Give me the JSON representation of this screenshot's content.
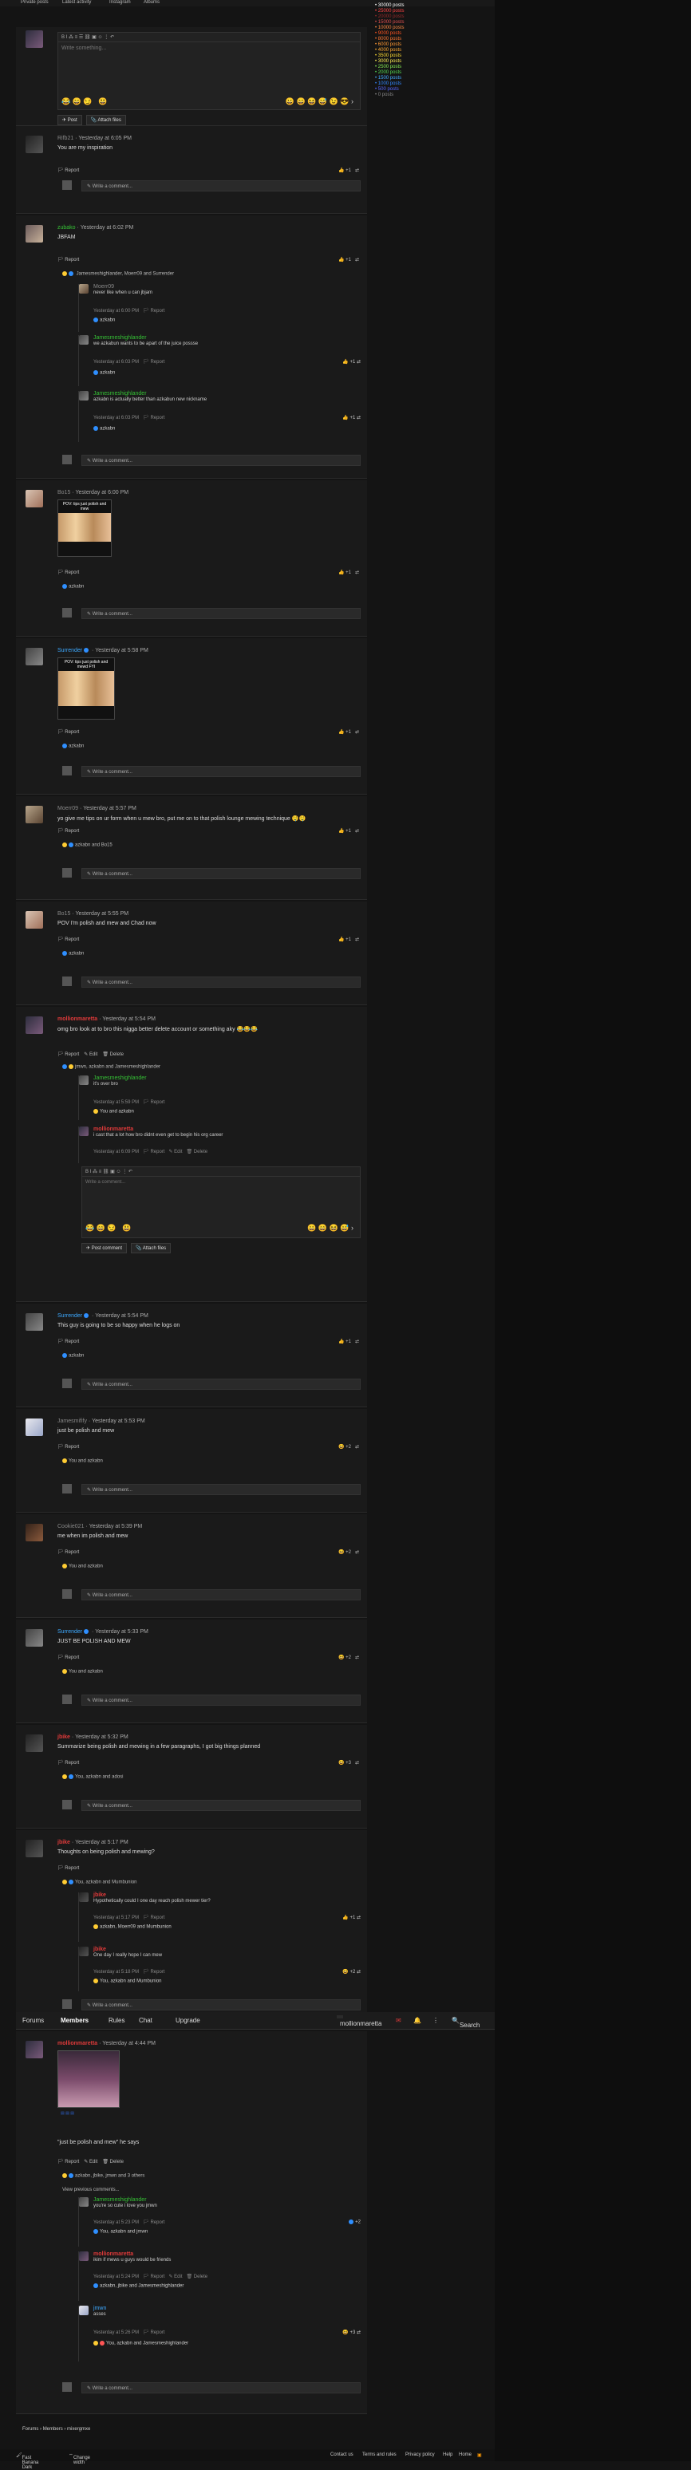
{
  "topnav": {
    "items": [
      "Private posts",
      "Latest activity",
      "Instagram",
      "Albums"
    ]
  },
  "sidebar": {
    "ranks": [
      {
        "label": "30000 posts",
        "color": "#ffffff"
      },
      {
        "label": "25000 posts",
        "color": "#ff4444"
      },
      {
        "label": "20000 posts",
        "color": "#9a2a2a"
      },
      {
        "label": "15000 posts",
        "color": "#e05050"
      },
      {
        "label": "10000 posts",
        "color": "#ff8844"
      },
      {
        "label": "9000 posts",
        "color": "#ff5522"
      },
      {
        "label": "8000 posts",
        "color": "#ff7733"
      },
      {
        "label": "6000 posts",
        "color": "#ff9933"
      },
      {
        "label": "4000 posts",
        "color": "#ffaa33"
      },
      {
        "label": "3500 posts",
        "color": "#ffdd33"
      },
      {
        "label": "3000 posts",
        "color": "#ffee55"
      },
      {
        "label": "2500 posts",
        "color": "#88ee55"
      },
      {
        "label": "2000 posts",
        "color": "#55dd55"
      },
      {
        "label": "1500 posts",
        "color": "#44aaff"
      },
      {
        "label": "1000 posts",
        "color": "#3388ff"
      },
      {
        "label": "500 posts",
        "color": "#5566ff"
      },
      {
        "label": "0 posts",
        "color": "#888888"
      }
    ]
  },
  "editor": {
    "placeholder": "Write something...",
    "post": "Post",
    "attach": "Attach files"
  },
  "posts": [
    {
      "user": "Rifb21",
      "time": "Yesterday at 6:05 PM",
      "text": "You are my inspiration",
      "likes": "+1",
      "actions": "Report",
      "comment": "Write a comment..."
    },
    {
      "user": "zubako",
      "time": "Yesterday at 6:02 PM",
      "text": "JBFAM",
      "reactors": "Jamesmeshighlander, Moerr09 and Surrender",
      "replies": [
        {
          "user": "Moerr09",
          "text": "never like when u can jbjam",
          "time": "Yesterday at 6:00 PM",
          "react": "azkabn"
        },
        {
          "user": "Jamesmeshighlander",
          "text": "we azkabun wants to be apart of the juice possse",
          "time": "Yesterday at 6:03 PM",
          "react": "azkabn"
        },
        {
          "user": "Jamesmeshighlander",
          "text": "azkabn is actually better than azkabun new nickname",
          "time": "Yesterday at 6:03 PM",
          "react": "azkabn"
        }
      ]
    },
    {
      "user": "Bo15",
      "time": "Yesterday at 6:00 PM",
      "meme": "POV: tips just polish and mew",
      "react": "azkabn"
    },
    {
      "user": "Surrender",
      "time": "Yesterday at 5:58 PM",
      "meme": "POV: tips just polish and mewd FYI",
      "react": "azkabn"
    },
    {
      "user": "Moerr09",
      "time": "Yesterday at 5:57 PM",
      "text": "yo give me tips on ur form when u mew bro, put me on to that polish lounge mewing technique",
      "react": "azkabn and Bo15"
    },
    {
      "user": "Bo15",
      "time": "Yesterday at 5:55 PM",
      "text": "POV I'm polish and mew and Chad now",
      "react": "azkabn"
    },
    {
      "user": "mollionmaretta",
      "time": "Yesterday at 5:54 PM",
      "text": "omg bro look at to bro this nigga better delete account or something aky",
      "react": "jmwn, azkabn and Jamesmeshighlander",
      "replies": [
        {
          "user": "Jamesmeshighlander",
          "text": "it's over bro",
          "time": "Yesterday at 5:59 PM",
          "react": "You and azkabn"
        },
        {
          "user": "mollionmaretta",
          "text": "i cast that a lot how bro didnt even get to begin his  org career",
          "time": "Yesterday at 6:09 PM"
        }
      ]
    },
    {
      "user": "Surrender",
      "time": "Yesterday at 5:54 PM",
      "text": "This guy is going to be so happy when he logs on",
      "react": "azkabn"
    },
    {
      "user": "Jamesmifify",
      "time": "Yesterday at 5:53 PM",
      "text": "just be polish and mew",
      "react": "You and azkabn"
    },
    {
      "user": "Cookie021",
      "time": "Yesterday at 5:39 PM",
      "text": "me when im polish and mew",
      "react": "You and azkabn"
    },
    {
      "user": "Surrender",
      "time": "Yesterday at 5:33 PM",
      "text": "JUST BE POLISH AND MEW",
      "react": "You and azkabn"
    },
    {
      "user": "jbike",
      "time": "Yesterday at 5:32 PM",
      "text": "Summarize being polish and mewing in a few paragraphs, I got big things planned",
      "react": "You, azkabn and adosi"
    },
    {
      "user": "jbike",
      "time": "Yesterday at 5:17 PM",
      "text": "Thoughts on being polish and mewing?",
      "react": "You, azkabn and Mumbunion",
      "replies": [
        {
          "user": "jbike",
          "text": "Hypothetically could I one day reach polish mewer tier?",
          "time": "Yesterday at 5:17 PM",
          "react": "azkabn, Moerr09 and Mumbunion"
        },
        {
          "user": "jbike",
          "text": "One day I really hope I can mew",
          "time": "Yesterday at 5:18 PM",
          "react": "You, azkabn and Mumbunion"
        }
      ]
    },
    {
      "user": "mollionmaretta",
      "time": "Yesterday at 4:44 PM",
      "text": "\"just be polish and mew\" he says",
      "react": "azkabn, jbike, jmwn and 3 others",
      "older": "View previous comments...",
      "replies": [
        {
          "user": "Jamesmeshighlander",
          "text": "you're so cute i love you jmwn",
          "time": "Yesterday at 5:23 PM",
          "react": "You, azkabn and jmwn"
        },
        {
          "user": "mollionmaretta",
          "text": "ikim if mews u guys would be friends",
          "time": "Yesterday at 5:24 PM",
          "react": "azkabn, jbike and Jamesmeshighlander"
        },
        {
          "user": "jmwn",
          "text": "asses",
          "time": "Yesterday at 5:26 PM",
          "react": "You, azkabn and Jamesmeshighlander"
        }
      ]
    }
  ],
  "forumbar": {
    "forums": "Forums",
    "members": "Members",
    "rules": "Rules",
    "chat": "Chat",
    "upgrade": "Upgrade",
    "user": "mollionmaretta",
    "search": "Search"
  },
  "breadcrumb": {
    "a": "Forums",
    "b": "Members",
    "c": "mixergmxe"
  },
  "footer": {
    "left1": "Fast Banana Dark",
    "left2": "Change width",
    "contact": "Contact us",
    "terms": "Terms and rules",
    "privacy": "Privacy policy",
    "help": "Help",
    "home": "Home"
  }
}
